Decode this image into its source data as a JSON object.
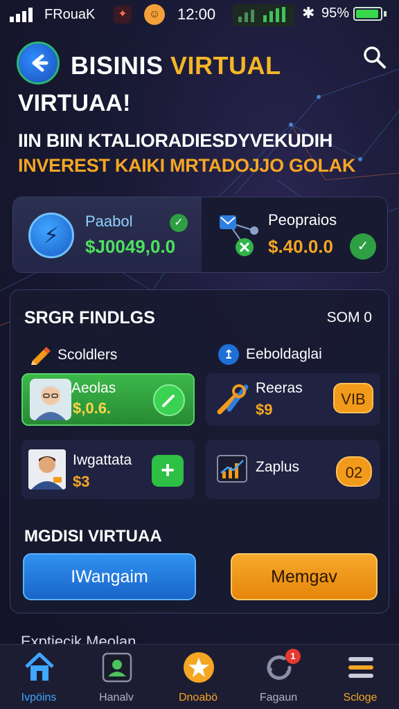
{
  "status_bar": {
    "carrier": "FRouaK",
    "time": "12:00",
    "battery_percent": "95%",
    "signal_icon": "signal-bars-icon",
    "bluetooth_icon": "bluetooth-icon",
    "battery_level": 0.95
  },
  "header": {
    "title_part1": "BISINIS",
    "title_part2": "VIRTUAL",
    "subtitle": "VIRTUAA!",
    "tagline_line1": "IIN BIIN KTALIORADIESDYVEKUDIH",
    "tagline_line2": "INVEREST KAIKI MRTADOJJO GOLAK",
    "back_icon": "back-arrow-icon",
    "search_icon": "search-icon"
  },
  "stats": {
    "left": {
      "label": "Paabol",
      "value": "$J0049,0.0"
    },
    "right": {
      "label": "Peopraios",
      "value": "$.40.0.0"
    }
  },
  "findings": {
    "title": "SRGR FINDLGS",
    "count": "SOM 0",
    "section_left": "Scoldlers",
    "section_right": "Eeboldaglai",
    "items": [
      {
        "name": "Aeolas",
        "value": "$,0.6."
      },
      {
        "name": "Reeras",
        "value": "$9",
        "badge": "VIB"
      },
      {
        "name": "Iwgattata",
        "value": "$3"
      },
      {
        "name": "Zaplus",
        "badge": "02"
      }
    ],
    "cta_title": "MGDISI VIRTUAA",
    "button_primary": "IWangaim",
    "button_secondary": "Memgav"
  },
  "more_label": "Exptiecik Meolan",
  "bottom_nav": [
    {
      "label": "Ivpöins",
      "icon": "home-icon"
    },
    {
      "label": "Hanalv",
      "icon": "profile-icon"
    },
    {
      "label": "Dnoabö",
      "icon": "star-icon"
    },
    {
      "label": "Fagaun",
      "icon": "refresh-icon",
      "badge": "1"
    },
    {
      "label": "Scloge",
      "icon": "menu-icon"
    }
  ],
  "colors": {
    "accent_orange": "#f5a623",
    "accent_blue": "#2f92f0",
    "accent_green": "#3cb84a",
    "background": "#191a35"
  }
}
